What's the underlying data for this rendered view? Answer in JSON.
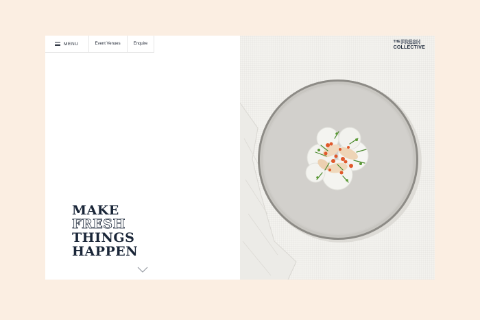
{
  "nav": {
    "menu_label": "MENU",
    "links": [
      "Event Venues",
      "Enquire"
    ]
  },
  "hero": {
    "headline_lines": [
      "MAKE",
      "FRESH",
      "THINGS",
      "HAPPEN"
    ]
  },
  "logo": {
    "the": "THE",
    "fresh": "FRESH",
    "collective": "COLLECTIVE"
  },
  "colors": {
    "page_background": "#fbeee2",
    "navy": "#1a2638",
    "white": "#ffffff"
  },
  "icons": {
    "menu": "hamburger-icon",
    "scroll": "chevron-down-icon"
  }
}
